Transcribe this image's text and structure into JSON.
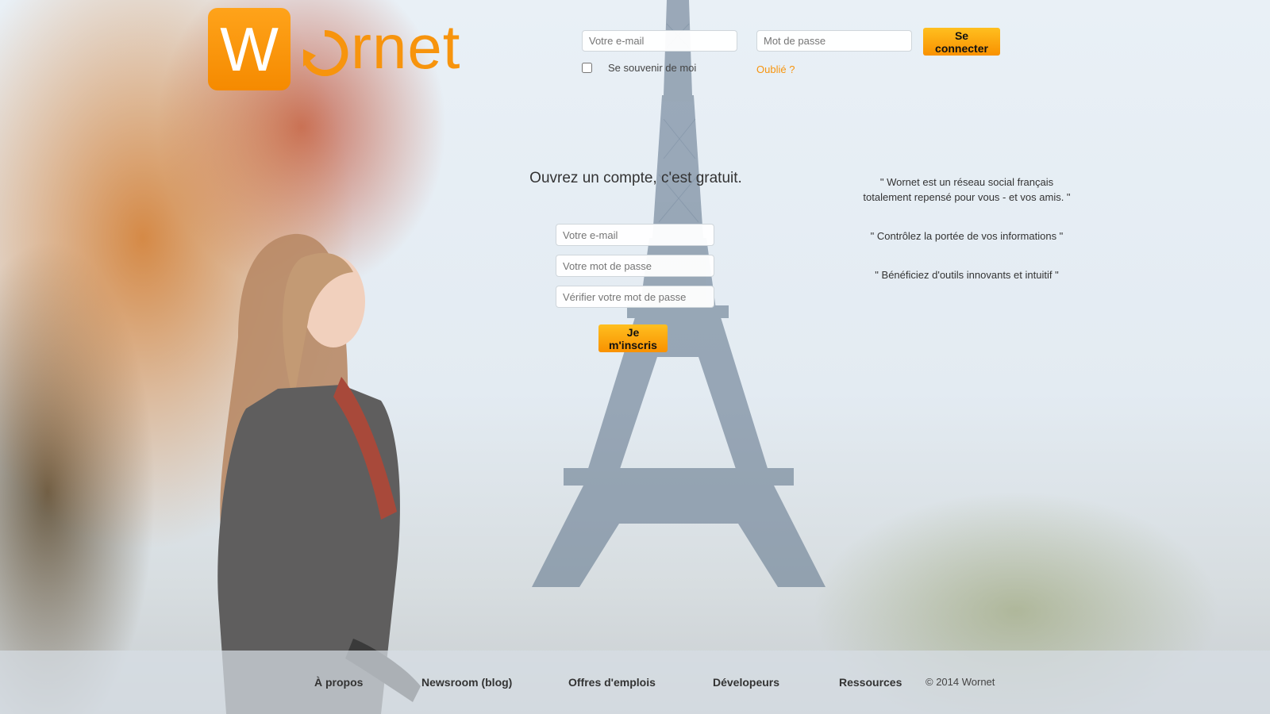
{
  "brand": {
    "logo_letter": "W",
    "logo_text": "rnet",
    "accent_color": "#f7940d"
  },
  "login": {
    "email_placeholder": "Votre e-mail",
    "password_placeholder": "Mot de passe",
    "submit_label": "Se connecter",
    "remember_label": "Se souvenir de moi",
    "forgot_label": "Oublié ?"
  },
  "signup": {
    "title": "Ouvrez un compte, c'est gratuit.",
    "email_placeholder": "Votre e-mail",
    "password_placeholder": "Votre mot de passe",
    "verify_placeholder": "Vérifier votre mot de passe",
    "submit_label": "Je m'inscris"
  },
  "quotes": [
    {
      "line1": "\" Wornet est un réseau social français",
      "line2": "totalement repensé pour vous - et vos amis. \""
    },
    {
      "line1": "\" Contrôlez la portée de vos informations \""
    },
    {
      "line1": "\" Bénéficiez d'outils innovants et intuitif \""
    }
  ],
  "footer": {
    "links": [
      "À propos",
      "Newsroom (blog)",
      "Offres d'emplois",
      "Dévelopeurs",
      "Ressources"
    ],
    "copyright": "© 2014 Wornet"
  },
  "icons": {
    "logo_loop": "circular-arrow-icon"
  }
}
